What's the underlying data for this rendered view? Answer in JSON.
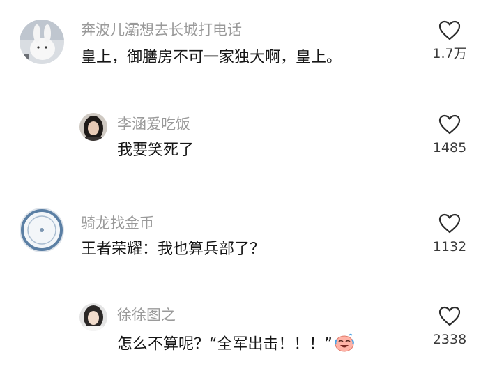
{
  "comments": [
    {
      "username": "奔波儿灞想去长城打电话",
      "text": "皇上，御膳房不可一家独大啊，皇上。",
      "likes": "1.7万",
      "avatar_icon": "bunny-photo-avatar"
    },
    {
      "username": "李涵爱吃饭",
      "text": "我要笑死了",
      "likes": "1485",
      "avatar_icon": "girl-photo-avatar"
    },
    {
      "username": "骑龙找金币",
      "text": "王者荣耀：我也算兵部了？",
      "likes": "1132",
      "avatar_icon": "plate-photo-avatar"
    },
    {
      "username": "徐徐图之",
      "text": "怎么不算呢？“全军出击！！！”",
      "likes": "2338",
      "avatar_icon": "girl-photo-avatar",
      "trailing_emoji": "laughing-crying-emoji"
    }
  ],
  "like_icon": "heart-outline-icon"
}
